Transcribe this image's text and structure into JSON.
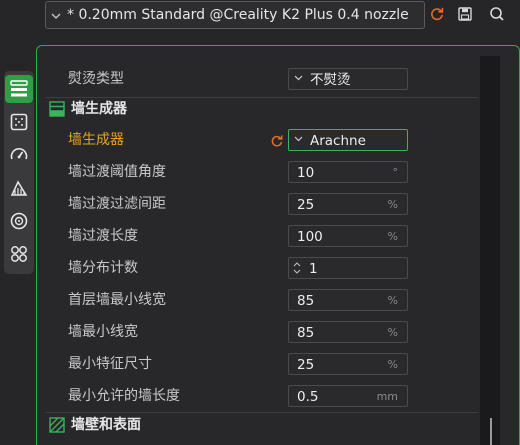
{
  "toolbar": {
    "preset_name": "* 0.20mm Standard @Creality K2 Plus 0.4 nozzle",
    "icons": [
      "refresh-icon",
      "save-icon",
      "search-icon"
    ]
  },
  "sidebar": {
    "items": [
      "quality-icon",
      "strength-icon",
      "speed-icon",
      "support-icon",
      "filament-icon",
      "others-icon"
    ],
    "active": "quality-icon"
  },
  "sections": {
    "ironing_row": {
      "label": "熨烫类型",
      "value": "不熨烫"
    },
    "wall_generator": {
      "title": "墙生成器",
      "rows": [
        {
          "label": "墙生成器",
          "value": "Arachne",
          "kind": "combo",
          "modified": true
        },
        {
          "label": "墙过渡阈值角度",
          "value": "10",
          "unit": "°",
          "kind": "number"
        },
        {
          "label": "墙过渡过滤间距",
          "value": "25",
          "unit": "%",
          "kind": "number"
        },
        {
          "label": "墙过渡长度",
          "value": "100",
          "unit": "%",
          "kind": "number"
        },
        {
          "label": "墙分布计数",
          "value": "1",
          "kind": "spin"
        },
        {
          "label": "首层墙最小线宽",
          "value": "85",
          "unit": "%",
          "kind": "number"
        },
        {
          "label": "墙最小线宽",
          "value": "85",
          "unit": "%",
          "kind": "number"
        },
        {
          "label": "最小特征尺寸",
          "value": "25",
          "unit": "%",
          "kind": "number"
        },
        {
          "label": "最小允许的墙长度",
          "value": "0.5",
          "unit": "mm",
          "kind": "number"
        }
      ]
    },
    "walls_surfaces": {
      "title": "墙壁和表面"
    }
  },
  "colors": {
    "accent_green": "#1fb24e",
    "highlight_orange": "#e8a21b",
    "background": "#262629"
  }
}
